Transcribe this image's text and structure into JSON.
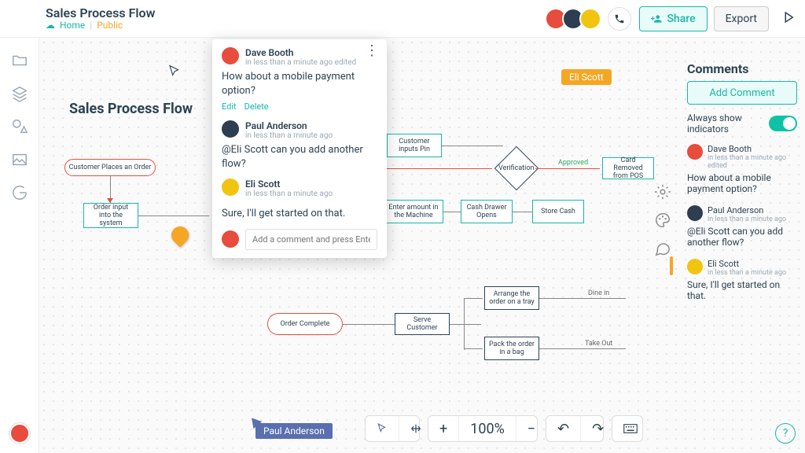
{
  "header": {
    "title": "Sales Process Flow",
    "home": "Home",
    "visibility": "Public",
    "share": "Share",
    "export": "Export"
  },
  "canvas": {
    "title": "Sales Process Flow",
    "nodes": {
      "start": "Customer Places an Order",
      "sysinput": "Order input into the system",
      "custpin": "Customer inputs Pin",
      "verify": "Verification",
      "cardremove": "Card Removed from POS",
      "enteramount": "Enter amount in the Machine",
      "draweropens": "Cash Drawer Opens",
      "storecash": "Store Cash",
      "arrangetray": "Arrange the order on a tray",
      "packbag": "Pack the order in a bag",
      "serve": "Serve Customer",
      "complete": "Order Complete"
    },
    "labels": {
      "approved": "Approved",
      "dinein": "Dine in",
      "takeout": "Take Out"
    },
    "highlight": "Eli Scott",
    "livecursor": "Paul Anderson"
  },
  "popup": {
    "comments": [
      {
        "author": "Dave Booth",
        "meta": "in less than a minute ago edited",
        "body": "How about a mobile payment option?"
      },
      {
        "author": "Paul Anderson",
        "meta": "in less than a minute ago",
        "body": "@Eli Scott can you add another flow?"
      },
      {
        "author": "Eli Scott",
        "meta": "in less than a minute ago",
        "body": "Sure, I'll get started on that."
      }
    ],
    "edit": "Edit",
    "delete": "Delete",
    "placeholder": "Add a comment and press Enter"
  },
  "panel": {
    "title": "Comments",
    "addComment": "Add Comment",
    "alwaysShow": "Always show indicators",
    "comments": [
      {
        "author": "Dave Booth",
        "meta": "in less than a minute ago edited",
        "body": "How about a mobile payment option?"
      },
      {
        "author": "Paul Anderson",
        "meta": "in less than a minute ago",
        "body": "@Eli Scott can you add another flow?"
      },
      {
        "author": "Eli Scott",
        "meta": "in less than a minute ago",
        "body": "Sure, I'll get started on that."
      }
    ]
  },
  "toolbar": {
    "zoom": "100%"
  }
}
